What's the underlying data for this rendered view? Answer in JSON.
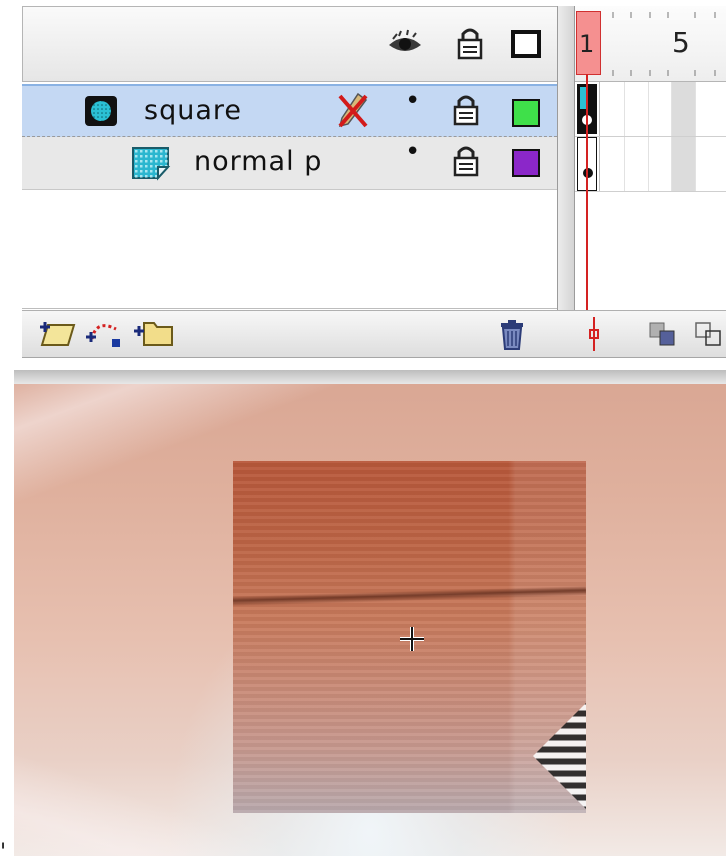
{
  "timeline": {
    "header_icons": [
      "eye-icon",
      "lock-icon",
      "outline-icon"
    ],
    "ruler": {
      "current_frame": "1",
      "frame_marker": "5"
    },
    "layers": [
      {
        "name": "square",
        "type": "mask",
        "selected": true,
        "icon": "mask-layer-icon",
        "edit_state_icon": "pencil-crossed-icon",
        "visibility": "•",
        "locked": true,
        "outline_color": "#3fe04a"
      },
      {
        "name": "normal p",
        "type": "masked",
        "selected": false,
        "icon": "masked-layer-icon",
        "visibility": "•",
        "locked": true,
        "outline_color": "#8b27c9"
      }
    ],
    "bottom_tools": [
      "insert-layer-icon",
      "add-motion-guide-icon",
      "insert-folder-icon",
      "delete-layer-icon"
    ],
    "onion_tools": [
      "onion-skin-icon",
      "onion-skin-outlines-icon"
    ]
  },
  "stage": {
    "left_mark": "'"
  }
}
